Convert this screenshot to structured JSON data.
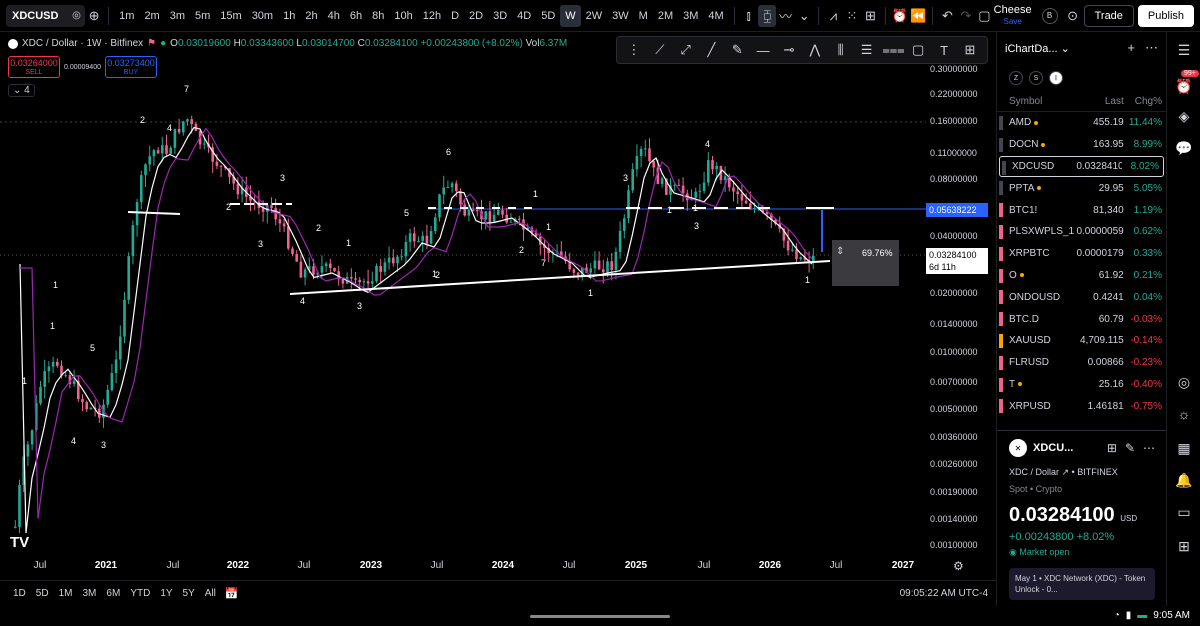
{
  "toolbar": {
    "symbol": "XDCUSD",
    "timeframes": [
      "1m",
      "2m",
      "3m",
      "5m",
      "15m",
      "30m",
      "1h",
      "2h",
      "4h",
      "6h",
      "8h",
      "10h",
      "12h",
      "D",
      "2D",
      "3D",
      "4D",
      "5D",
      "W",
      "2W",
      "3W",
      "M",
      "2M",
      "3M",
      "4M"
    ],
    "active_timeframe": "W",
    "account_name": "Cheese",
    "account_status": "Save",
    "avatar_letter": "B",
    "trade_label": "Trade",
    "publish_label": "Publish"
  },
  "legend": {
    "title": "XDC / Dollar · 1W · Bitfinex",
    "open_label": "O",
    "open": "0.03019600",
    "high_label": "H",
    "high": "0.03343600",
    "low_label": "L",
    "low": "0.03014700",
    "close_label": "C",
    "close": "0.03284100",
    "change": "+0.00243800 (+8.02%)",
    "vol_label": "Vol",
    "vol": "6.37M",
    "sell_price": "0.03264000",
    "sell_label": "SELL",
    "spread": "0.00009400",
    "buy_price": "0.03273400",
    "buy_label": "BUY",
    "indicators_count": "4"
  },
  "price_axis": [
    "0.30000000",
    "0.22000000",
    "0.16000000",
    "0.11000000",
    "0.08000000",
    "0.06000000",
    "0.04000000",
    "0.03000000",
    "0.02000000",
    "0.01400000",
    "0.01000000",
    "0.00700000",
    "0.00500000",
    "0.00360000",
    "0.00260000",
    "0.00190000",
    "0.00140000",
    "0.00100000"
  ],
  "price_tags": {
    "level": "0.05638222",
    "current": "0.03284100",
    "countdown": "6d 11h"
  },
  "measure_label": "69.76%",
  "time_axis": [
    {
      "label": "Jul",
      "year": false
    },
    {
      "label": "2021",
      "year": true
    },
    {
      "label": "Jul",
      "year": false
    },
    {
      "label": "2022",
      "year": true
    },
    {
      "label": "Jul",
      "year": false
    },
    {
      "label": "2023",
      "year": true
    },
    {
      "label": "Jul",
      "year": false
    },
    {
      "label": "2024",
      "year": true
    },
    {
      "label": "Jul",
      "year": false
    },
    {
      "label": "2025",
      "year": true
    },
    {
      "label": "Jul",
      "year": false
    },
    {
      "label": "2026",
      "year": true
    },
    {
      "label": "Jul",
      "year": false
    },
    {
      "label": "2027",
      "year": true
    }
  ],
  "wave_labels": [
    "7",
    "2",
    "4",
    "2",
    "3",
    "3",
    "2",
    "1",
    "4",
    "3",
    "6",
    "5",
    "1",
    "2",
    "2",
    "1",
    "7",
    "1",
    "3",
    "1",
    "1",
    "4",
    "3",
    "1",
    "1",
    "1",
    "5",
    "1",
    "4",
    "3",
    "1"
  ],
  "ranges": [
    "1D",
    "5D",
    "1M",
    "3M",
    "6M",
    "YTD",
    "1Y",
    "5Y",
    "All"
  ],
  "clock": "09:05:22 AM UTC-4",
  "logo": "TV",
  "status_time": "9:05 AM",
  "watchlist": {
    "name": "iChartDa...",
    "filters": [
      "Z",
      "S",
      "I"
    ],
    "columns": {
      "symbol": "Symbol",
      "last": "Last",
      "chg": "Chg%"
    },
    "rows": [
      {
        "symbol": "AMD",
        "last": "455.19",
        "chg": "11.44%",
        "dir": "pos",
        "dot": true,
        "flag": "#434651"
      },
      {
        "symbol": "DOCN",
        "last": "163.95",
        "chg": "8.99%",
        "dir": "pos",
        "dot": true,
        "flag": "#434651"
      },
      {
        "symbol": "XDCUSD",
        "last": "0.03284100",
        "chg": "8.02%",
        "dir": "pos",
        "dot": false,
        "flag": "#434651",
        "selected": true
      },
      {
        "symbol": "PPTA",
        "last": "29.95",
        "chg": "5.05%",
        "dir": "pos",
        "dot": true,
        "flag": "#434651"
      },
      {
        "symbol": "BTC1!",
        "last": "81,340",
        "chg": "1.19%",
        "dir": "pos",
        "dot": false,
        "flag": "#f06292"
      },
      {
        "symbol": "PLSXWPLS_1",
        "last": "0.0000059",
        "chg": "0.62%",
        "dir": "pos",
        "dot": false,
        "flag": "#f06292"
      },
      {
        "symbol": "XRPBTC",
        "last": "0.0000179",
        "chg": "0.33%",
        "dir": "pos",
        "dot": false,
        "flag": "#f06292"
      },
      {
        "symbol": "O",
        "last": "61.92",
        "chg": "0.21%",
        "dir": "pos",
        "dot": true,
        "flag": "#f06292"
      },
      {
        "symbol": "ONDOUSD",
        "last": "0.4241",
        "chg": "0.04%",
        "dir": "pos",
        "dot": false,
        "flag": "#f06292"
      },
      {
        "symbol": "BTC.D",
        "last": "60.79",
        "chg": "-0.03%",
        "dir": "neg",
        "dot": false,
        "flag": "#f06292"
      },
      {
        "symbol": "XAUUSD",
        "last": "4,709.115",
        "chg": "-0.14%",
        "dir": "neg",
        "dot": false,
        "flag": "#f7a600"
      },
      {
        "symbol": "FLRUSD",
        "last": "0.00866",
        "chg": "-0.23%",
        "dir": "neg",
        "dot": false,
        "flag": "#f06292"
      },
      {
        "symbol": "T",
        "last": "25.16",
        "chg": "-0.40%",
        "dir": "neg",
        "dot": true,
        "flag": "#f06292"
      },
      {
        "symbol": "XRPUSD",
        "last": "1.46181",
        "chg": "-0.75%",
        "dir": "neg",
        "dot": false,
        "flag": "#f06292"
      }
    ]
  },
  "detail": {
    "symbol": "XDCU...",
    "name": "XDC / Dollar",
    "exchange": "BITFINEX",
    "type": "Spot • Crypto",
    "price": "0.03284100",
    "currency": "USD",
    "change": "+0.00243800 +8.02%",
    "market": "Market open",
    "event": "May 1 • XDC Network (XDC) - Token Unlock - 0..."
  },
  "badge": "99+",
  "colors": {
    "up": "#22ab94",
    "down": "#f23645",
    "accent": "#2962ff",
    "pink": "#f06292",
    "level": "#2962ff"
  }
}
